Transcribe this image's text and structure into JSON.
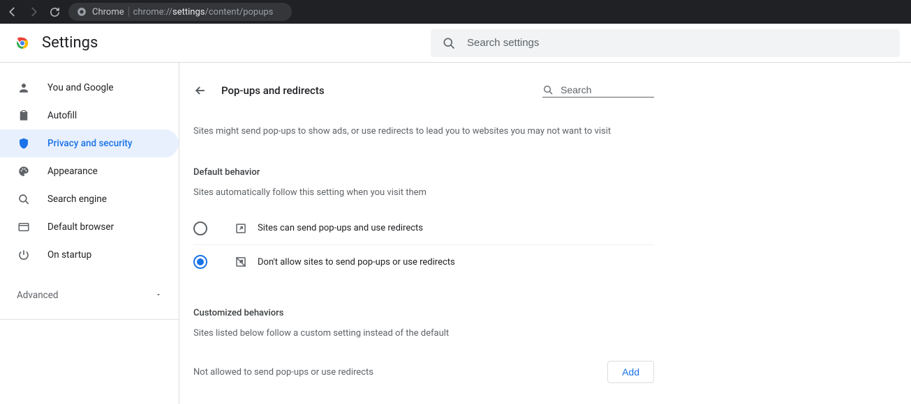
{
  "browser": {
    "url_host": "Chrome",
    "url_path_prefix": "chrome://",
    "url_path_strong": "settings",
    "url_path_rest": "/content/popups"
  },
  "header": {
    "title": "Settings",
    "search_placeholder": "Search settings"
  },
  "sidebar": {
    "items": [
      {
        "label": "You and Google",
        "icon": "person-icon",
        "active": false
      },
      {
        "label": "Autofill",
        "icon": "clipboard-icon",
        "active": false
      },
      {
        "label": "Privacy and security",
        "icon": "shield-icon",
        "active": true
      },
      {
        "label": "Appearance",
        "icon": "palette-icon",
        "active": false
      },
      {
        "label": "Search engine",
        "icon": "search-icon",
        "active": false
      },
      {
        "label": "Default browser",
        "icon": "browser-icon",
        "active": false
      },
      {
        "label": "On startup",
        "icon": "power-icon",
        "active": false
      }
    ],
    "advanced_label": "Advanced"
  },
  "main": {
    "title": "Pop-ups and redirects",
    "search_placeholder": "Search",
    "description": "Sites might send pop-ups to show ads, or use redirects to lead you to websites you may not want to visit",
    "default_behavior": {
      "title": "Default behavior",
      "subtitle": "Sites automatically follow this setting when you visit them",
      "options": [
        {
          "label": "Sites can send pop-ups and use redirects",
          "selected": false,
          "icon": "open-icon"
        },
        {
          "label": "Don't allow sites to send pop-ups or use redirects",
          "selected": true,
          "icon": "open-blocked-icon"
        }
      ]
    },
    "custom": {
      "title": "Customized behaviors",
      "subtitle": "Sites listed below follow a custom setting instead of the default",
      "not_allowed_label": "Not allowed to send pop-ups or use redirects",
      "add_button": "Add"
    }
  }
}
